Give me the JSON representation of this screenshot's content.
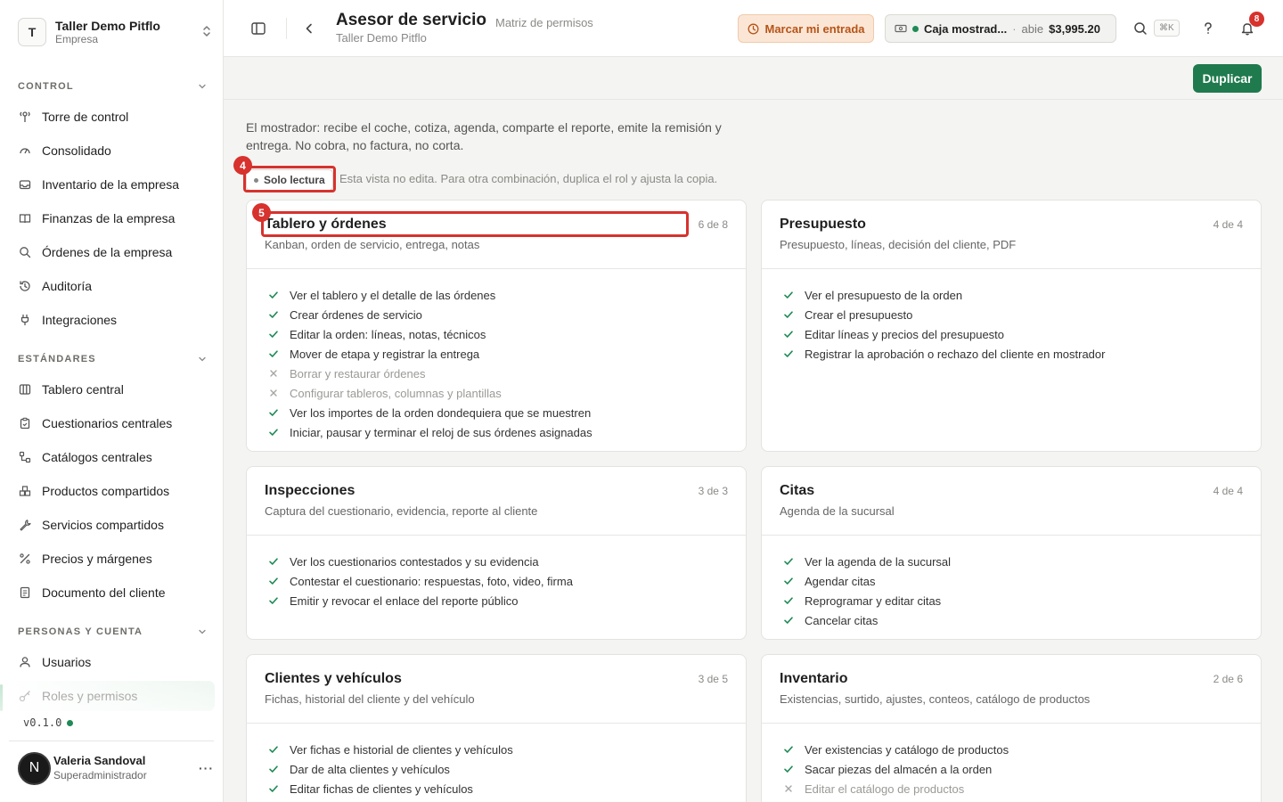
{
  "org": {
    "initial": "T",
    "name": "Taller Demo Pitflo",
    "type": "Empresa"
  },
  "sidebar": {
    "sections": [
      {
        "label": "CONTROL"
      },
      {
        "label": "ESTÁNDARES"
      },
      {
        "label": "PERSONAS Y CUENTA"
      }
    ],
    "items": [
      {
        "label": "Torre de control",
        "icon": "tower-icon"
      },
      {
        "label": "Consolidado",
        "icon": "gauge-icon"
      },
      {
        "label": "Inventario de la empresa",
        "icon": "inbox-icon"
      },
      {
        "label": "Finanzas de la empresa",
        "icon": "book-icon"
      },
      {
        "label": "Órdenes de la empresa",
        "icon": "search-icon"
      },
      {
        "label": "Auditoría",
        "icon": "history-icon"
      },
      {
        "label": "Integraciones",
        "icon": "plug-icon"
      },
      {
        "label": "Tablero central",
        "icon": "columns-icon"
      },
      {
        "label": "Cuestionarios centrales",
        "icon": "clipboard-icon"
      },
      {
        "label": "Catálogos centrales",
        "icon": "workflow-icon"
      },
      {
        "label": "Productos compartidos",
        "icon": "boxes-icon"
      },
      {
        "label": "Servicios compartidos",
        "icon": "wrench-icon"
      },
      {
        "label": "Precios y márgenes",
        "icon": "percent-icon"
      },
      {
        "label": "Documento del cliente",
        "icon": "document-icon"
      },
      {
        "label": "Usuarios",
        "icon": "user-icon"
      },
      {
        "label": "Roles y permisos",
        "icon": "key-icon"
      }
    ],
    "version": "v0.1.0"
  },
  "user": {
    "initial": "N",
    "name": "Valeria Sandoval",
    "role": "Superadministrador"
  },
  "header": {
    "title": "Asesor de servicio",
    "crumb": "Matriz de permisos",
    "subtitle": "Taller Demo Pitflo",
    "clock_in": "Marcar mi entrada",
    "register": {
      "name": "Caja mostrad...",
      "status": "abie",
      "amount": "$3,995.20"
    },
    "shortcut": "⌘K",
    "notifications": "8"
  },
  "toolbar": {
    "duplicate": "Duplicar"
  },
  "role": {
    "description": "El mostrador: recibe el coche, cotiza, agenda, comparte el reporte, emite la remisión y entrega. No cobra, no factura, no corta.",
    "badge": "Solo lectura",
    "note": "Esta vista no edita. Para otra combinación, duplica el rol y ajusta la copia."
  },
  "annotations": {
    "a4": "4",
    "a5": "5"
  },
  "colors": {
    "accent": "#1f7a4d",
    "warning": "#b65417",
    "annotation": "#d7322d"
  },
  "cards": [
    {
      "title": "Tablero y órdenes",
      "count": "6 de 8",
      "subtitle": "Kanban, orden de servicio, entrega, notas",
      "perms": [
        {
          "text": "Ver el tablero y el detalle de las órdenes",
          "on": true
        },
        {
          "text": "Crear órdenes de servicio",
          "on": true
        },
        {
          "text": "Editar la orden: líneas, notas, técnicos",
          "on": true
        },
        {
          "text": "Mover de etapa y registrar la entrega",
          "on": true
        },
        {
          "text": "Borrar y restaurar órdenes",
          "on": false
        },
        {
          "text": "Configurar tableros, columnas y plantillas",
          "on": false
        },
        {
          "text": "Ver los importes de la orden dondequiera que se muestren",
          "on": true
        },
        {
          "text": "Iniciar, pausar y terminar el reloj de sus órdenes asignadas",
          "on": true
        }
      ]
    },
    {
      "title": "Presupuesto",
      "count": "4 de 4",
      "subtitle": "Presupuesto, líneas, decisión del cliente, PDF",
      "perms": [
        {
          "text": "Ver el presupuesto de la orden",
          "on": true
        },
        {
          "text": "Crear el presupuesto",
          "on": true
        },
        {
          "text": "Editar líneas y precios del presupuesto",
          "on": true
        },
        {
          "text": "Registrar la aprobación o rechazo del cliente en mostrador",
          "on": true
        }
      ]
    },
    {
      "title": "Inspecciones",
      "count": "3 de 3",
      "subtitle": "Captura del cuestionario, evidencia, reporte al cliente",
      "perms": [
        {
          "text": "Ver los cuestionarios contestados y su evidencia",
          "on": true
        },
        {
          "text": "Contestar el cuestionario: respuestas, foto, video, firma",
          "on": true
        },
        {
          "text": "Emitir y revocar el enlace del reporte público",
          "on": true
        }
      ]
    },
    {
      "title": "Citas",
      "count": "4 de 4",
      "subtitle": "Agenda de la sucursal",
      "perms": [
        {
          "text": "Ver la agenda de la sucursal",
          "on": true
        },
        {
          "text": "Agendar citas",
          "on": true
        },
        {
          "text": "Reprogramar y editar citas",
          "on": true
        },
        {
          "text": "Cancelar citas",
          "on": true
        }
      ]
    },
    {
      "title": "Clientes y vehículos",
      "count": "3 de 5",
      "subtitle": "Fichas, historial del cliente y del vehículo",
      "perms": [
        {
          "text": "Ver fichas e historial de clientes y vehículos",
          "on": true
        },
        {
          "text": "Dar de alta clientes y vehículos",
          "on": true
        },
        {
          "text": "Editar fichas de clientes y vehículos",
          "on": true
        }
      ]
    },
    {
      "title": "Inventario",
      "count": "2 de 6",
      "subtitle": "Existencias, surtido, ajustes, conteos, catálogo de productos",
      "perms": [
        {
          "text": "Ver existencias y catálogo de productos",
          "on": true
        },
        {
          "text": "Sacar piezas del almacén a la orden",
          "on": true
        },
        {
          "text": "Editar el catálogo de productos",
          "on": false
        }
      ]
    }
  ]
}
